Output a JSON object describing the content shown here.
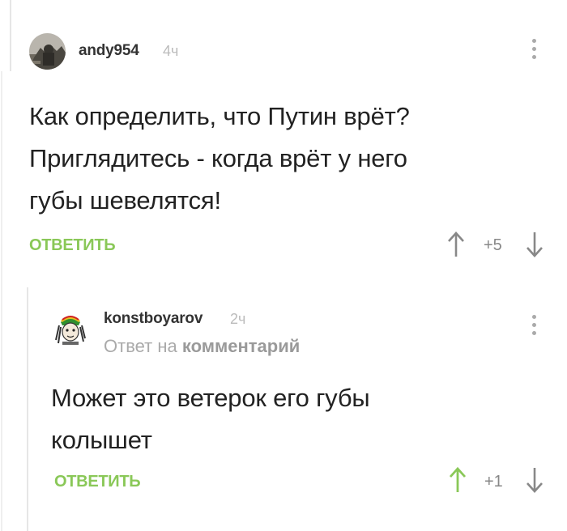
{
  "comment1": {
    "username": "andy954",
    "time": "4ч",
    "text_lines": [
      "Как определить, что Путин врёт?",
      "Приглядитесь - когда врёт у него",
      "губы шевелятся!"
    ],
    "reply_label": "ОТВЕТИТЬ",
    "rating": "+5"
  },
  "comment2": {
    "username": "konstboyarov",
    "time": "2ч",
    "reply_to_prefix": "Ответ на",
    "reply_to_target": "комментарий",
    "text_lines": [
      "Может это ветерок его губы",
      "колышет"
    ],
    "reply_label": "ОТВЕТИТЬ",
    "rating": "+1"
  },
  "colors": {
    "accent_green": "#8ac858",
    "thread_line": "#e6e6e6",
    "muted": "#aaaaaa"
  }
}
